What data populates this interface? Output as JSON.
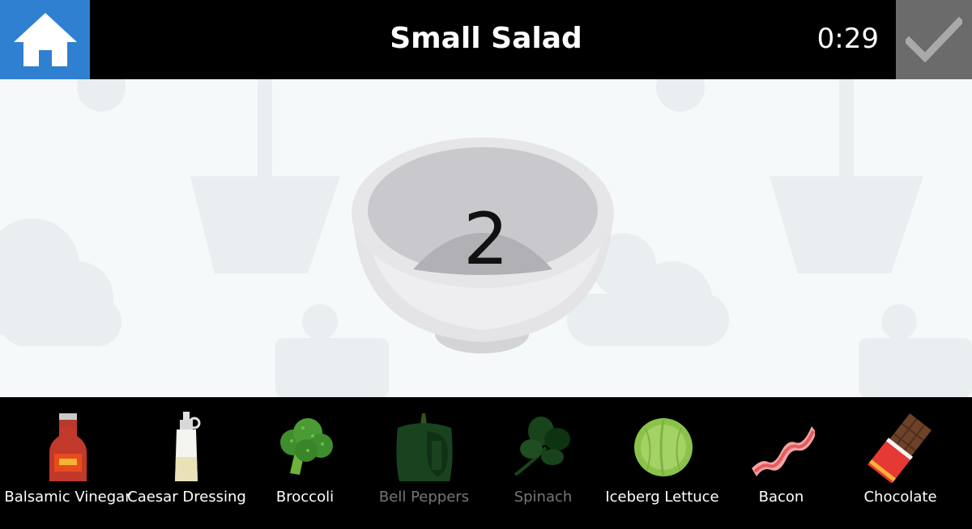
{
  "header": {
    "title": "Small Salad",
    "timer": "0:29",
    "home_icon": "home-icon",
    "done_icon": "checkmark-icon"
  },
  "colors": {
    "home_button": "#2f80d1",
    "done_button": "#6b6b6b",
    "stage_background": "#f6f9fa"
  },
  "bowl": {
    "count": "2"
  },
  "ingredients": [
    {
      "label": "Balsamic Vinegar",
      "icon": "balsamic-vinegar-icon",
      "enabled": true
    },
    {
      "label": "Caesar Dressing",
      "icon": "caesar-dressing-icon",
      "enabled": true
    },
    {
      "label": "Broccoli",
      "icon": "broccoli-icon",
      "enabled": true
    },
    {
      "label": "Bell Peppers",
      "icon": "bell-pepper-icon",
      "enabled": false
    },
    {
      "label": "Spinach",
      "icon": "spinach-icon",
      "enabled": false
    },
    {
      "label": "Iceberg Lettuce",
      "icon": "lettuce-icon",
      "enabled": true
    },
    {
      "label": "Bacon",
      "icon": "bacon-icon",
      "enabled": true
    },
    {
      "label": "Chocolate",
      "icon": "chocolate-icon",
      "enabled": true
    }
  ]
}
